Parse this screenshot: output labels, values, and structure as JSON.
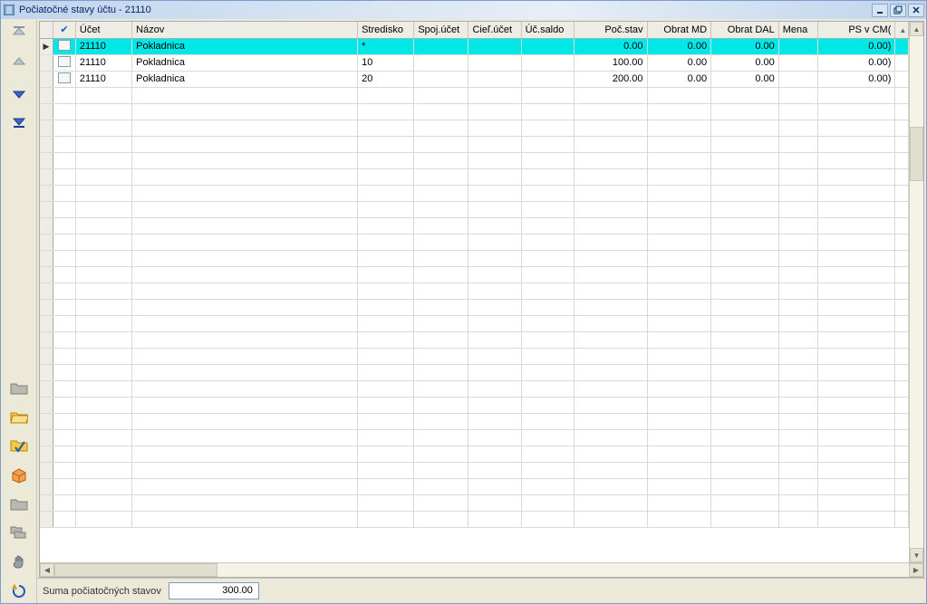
{
  "window": {
    "title": "Počiatočné stavy účtu - 21110"
  },
  "toolbar_left": {
    "first": "first-record",
    "prev": "previous-record",
    "next": "next-record",
    "last": "last-record",
    "folder_closed_1": "folder-closed",
    "folder_open": "folder-open",
    "check_folder": "check-folder",
    "box": "box",
    "folder_closed_2": "folder-closed",
    "folders": "folders-cascade",
    "hand": "hand-tool",
    "refresh": "refresh"
  },
  "columns": {
    "check": "✔",
    "ucet": "Účet",
    "nazov": "Názov",
    "stredisko": "Stredisko",
    "spoj": "Spoj.účet",
    "ciel": "Cieľ.účet",
    "saldo": "Úč.saldo",
    "poc": "Poč.stav",
    "md": "Obrat MD",
    "dal": "Obrat DAL",
    "mena": "Mena",
    "pscm": "PS v CM(",
    "sorter": "▲"
  },
  "rows": [
    {
      "selected": true,
      "ucet": "21110",
      "nazov": "Pokladnica",
      "stredisko": "*",
      "spoj": "",
      "ciel": "",
      "saldo": "",
      "poc": "0.00",
      "md": "0.00",
      "dal": "0.00",
      "mena": "",
      "pscm": "0.00)"
    },
    {
      "selected": false,
      "ucet": "21110",
      "nazov": "Pokladnica",
      "stredisko": "10",
      "spoj": "",
      "ciel": "",
      "saldo": "",
      "poc": "100.00",
      "md": "0.00",
      "dal": "0.00",
      "mena": "",
      "pscm": "0.00)"
    },
    {
      "selected": false,
      "ucet": "21110",
      "nazov": "Pokladnica",
      "stredisko": "20",
      "spoj": "",
      "ciel": "",
      "saldo": "",
      "poc": "200.00",
      "md": "0.00",
      "dal": "0.00",
      "mena": "",
      "pscm": "0.00)"
    }
  ],
  "empty_row_count": 27,
  "footer": {
    "label": "Suma počiatočných stavov",
    "value": "300.00"
  }
}
